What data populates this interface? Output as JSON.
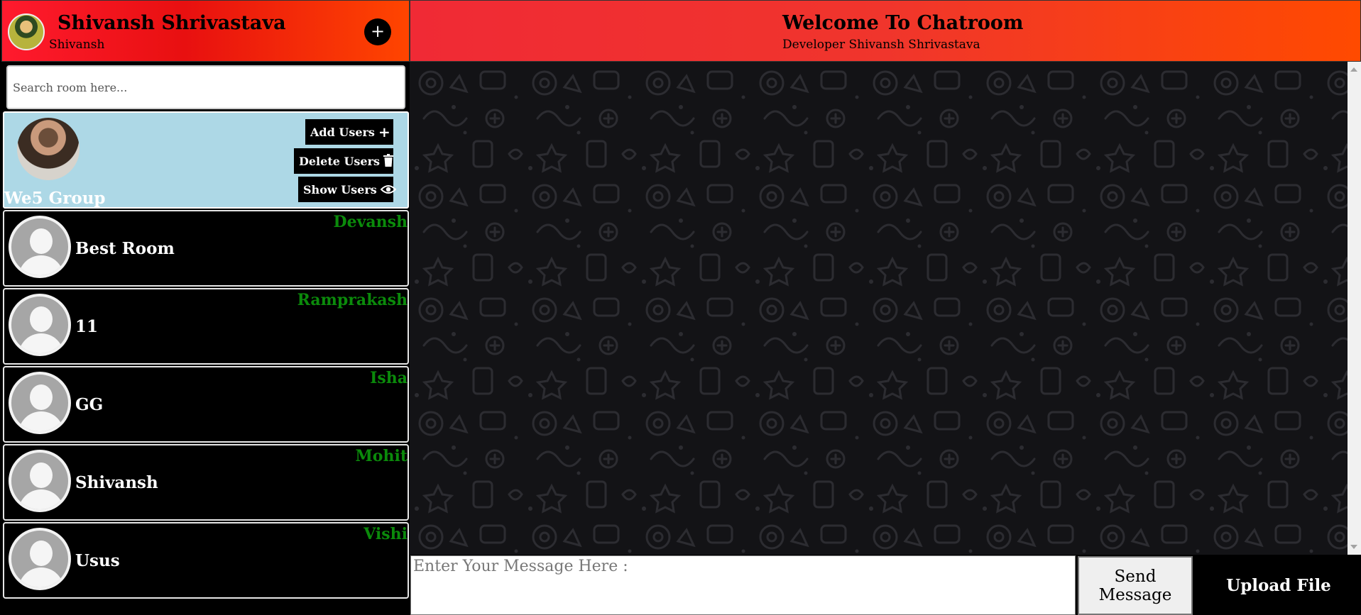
{
  "user": {
    "name": "Shivansh Shrivastava",
    "username": "Shivansh",
    "add_room_icon": "+"
  },
  "search": {
    "placeholder": "Search room here..."
  },
  "active_room": {
    "name": "We5 Group",
    "add_users_label": "Add Users",
    "add_users_icon": "+",
    "delete_users_label": "Delete Users",
    "delete_users_icon": "trash-icon",
    "show_users_label": "Show Users",
    "show_users_icon": "eye-icon"
  },
  "rooms": [
    {
      "name": "Best Room",
      "last_user": "Devansh"
    },
    {
      "name": "11",
      "last_user": "Ramprakash"
    },
    {
      "name": "GG",
      "last_user": "Isha"
    },
    {
      "name": "Shivansh",
      "last_user": "Mohit"
    },
    {
      "name": "Usus",
      "last_user": "Vishi"
    }
  ],
  "chat": {
    "title": "Welcome To Chatroom",
    "subtitle": "Developer Shivansh Shrivastava"
  },
  "composer": {
    "placeholder": "Enter Your Message Here :",
    "send_label": "Send Message",
    "upload_label": "Upload File"
  },
  "colors": {
    "header_gradient_start": "#ff1a2e",
    "header_gradient_end": "#ff4500",
    "active_room_bg": "#add8e6",
    "last_user_text": "#0b8a0b",
    "chat_background": "#131316"
  }
}
